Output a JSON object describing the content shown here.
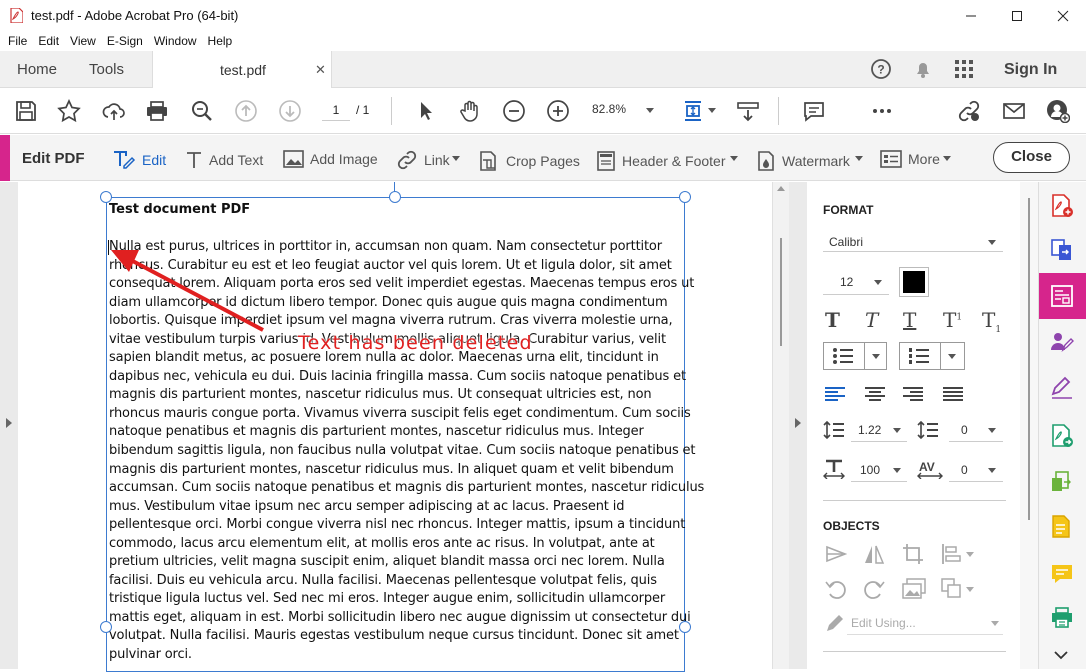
{
  "window": {
    "title": "test.pdf - Adobe Acrobat Pro (64-bit)"
  },
  "menu": [
    "File",
    "Edit",
    "View",
    "E-Sign",
    "Window",
    "Help"
  ],
  "tabs": {
    "home": "Home",
    "tools": "Tools",
    "document": "test.pdf",
    "sign_in": "Sign In"
  },
  "toolbar": {
    "page_current": "1",
    "page_separator": "/ 1",
    "zoom": "82.8%"
  },
  "edit_bar": {
    "title": "Edit PDF",
    "edit": "Edit",
    "add_text": "Add Text",
    "add_image": "Add Image",
    "link": "Link",
    "crop_pages": "Crop Pages",
    "header_footer": "Header & Footer",
    "watermark": "Watermark",
    "more": "More",
    "close": "Close"
  },
  "document": {
    "title": "Test document PDF",
    "lines": [
      "Nulla est purus, ultrices in porttitor in, accumsan non quam. Nam consectetur porttitor",
      "rhoncus. Curabitur eu est et leo feugiat auctor vel quis lorem. Ut et ligula dolor, sit amet",
      "consequat lorem. Aliquam porta eros sed velit imperdiet egestas. Maecenas tempus eros ut",
      "diam ullamcorper id dictum libero tempor. Donec quis augue quis magna condimentum",
      "lobortis. Quisque imperdiet ipsum vel magna viverra rutrum. Cras viverra molestie urna,",
      "vitae vestibulum turpis varius id. Vestibulum mollis aliquet ligula. Curabitur varius, velit",
      "sapien blandit metus, ac posuere lorem nulla ac dolor. Maecenas urna elit, tincidunt in",
      "dapibus nec, vehicula eu dui. Duis lacinia fringilla massa. Cum sociis natoque penatibus et",
      "magnis dis parturient montes, nascetur ridiculus mus. Ut consequat ultricies est, non",
      "rhoncus mauris congue porta. Vivamus viverra suscipit felis eget condimentum. Cum sociis",
      "natoque penatibus et magnis dis parturient montes, nascetur ridiculus mus. Integer",
      "bibendum sagittis ligula, non faucibus nulla volutpat vitae. Cum sociis natoque penatibus et",
      "magnis dis parturient montes, nascetur ridiculus mus.  In aliquet quam et velit bibendum",
      "accumsan. Cum sociis natoque penatibus et magnis dis parturient montes, nascetur ridiculus",
      "mus. Vestibulum vitae ipsum nec arcu semper adipiscing at ac lacus. Praesent id",
      "pellentesque orci. Morbi congue viverra nisl nec rhoncus. Integer mattis, ipsum a tincidunt",
      "commodo, lacus arcu elementum elit, at mollis eros ante ac risus. In volutpat, ante at",
      "pretium ultricies, velit magna suscipit enim, aliquet blandit massa orci nec lorem. Nulla",
      "facilisi. Duis eu vehicula arcu. Nulla facilisi. Maecenas pellentesque volutpat felis, quis",
      "tristique ligula luctus vel. Sed nec mi eros. Integer augue enim, sollicitudin ullamcorper",
      "mattis eget, aliquam in est. Morbi sollicitudin libero nec augue dignissim ut consectetur dui",
      "volutpat. Nulla facilisi. Mauris egestas vestibulum neque cursus tincidunt. Donec sit amet",
      "pulvinar orci."
    ],
    "annotation": "Text has been deleted"
  },
  "format_panel": {
    "format_heading": "FORMAT",
    "font": "Calibri",
    "font_size": "12",
    "font_color": "#000000",
    "line_spacing": "1.22",
    "paragraph_spacing": "0",
    "horizontal_scaling": "100",
    "char_spacing": "0",
    "objects_heading": "OBJECTS",
    "edit_using": "Edit Using..."
  },
  "colors": {
    "accent": "#d6258c",
    "selection": "#3d7bd0",
    "annotation": "#e02020"
  }
}
